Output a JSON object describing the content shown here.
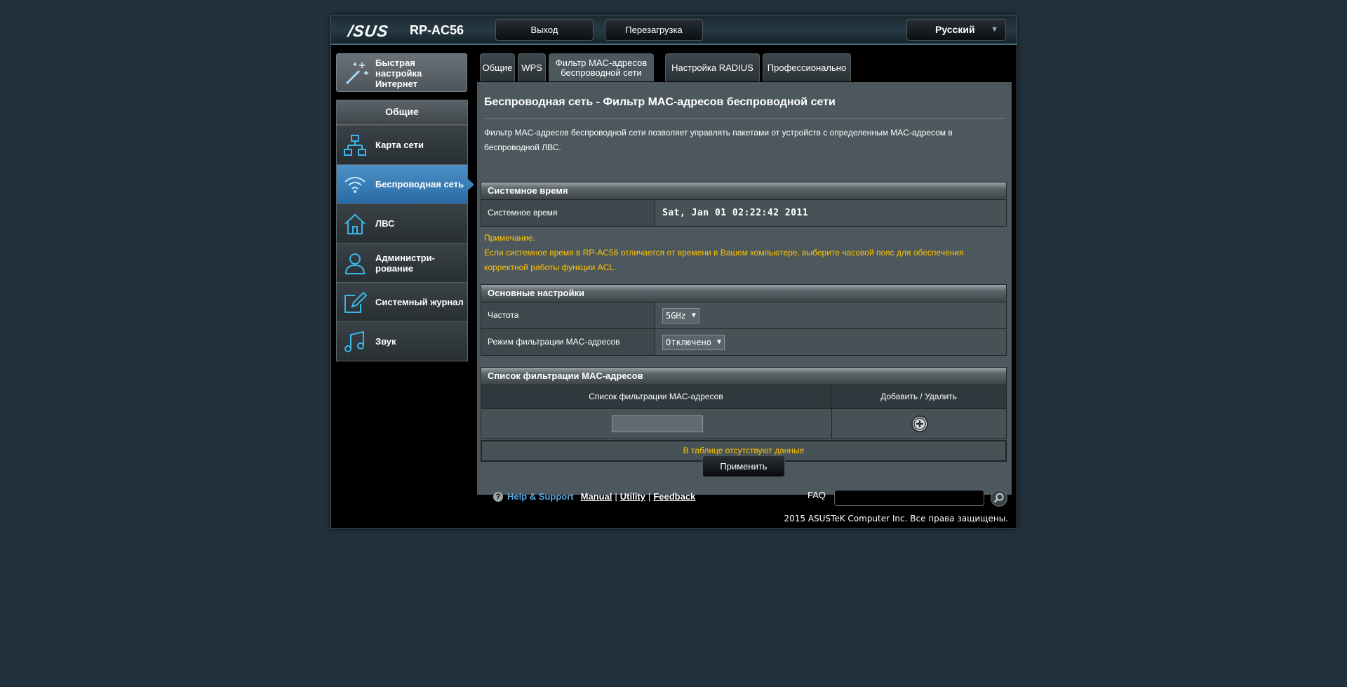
{
  "header": {
    "logo_text": "/SUS",
    "model": "RP-AC56",
    "logout_label": "Выход",
    "reboot_label": "Перезагрузка",
    "language": "Русский"
  },
  "sidebar": {
    "qis_label": "Быстрая настройка Интернет",
    "section_title": "Общие",
    "items": [
      {
        "label": "Карта сети",
        "icon": "network-map-icon"
      },
      {
        "label": "Беспроводная сеть",
        "icon": "wifi-icon"
      },
      {
        "label": "ЛВС",
        "icon": "home-icon"
      },
      {
        "label": "Администри-рование",
        "icon": "admin-icon"
      },
      {
        "label": "Системный журнал",
        "icon": "log-icon"
      },
      {
        "label": "Звук",
        "icon": "music-icon"
      }
    ]
  },
  "tabs": [
    {
      "label": "Общие"
    },
    {
      "label": "WPS"
    },
    {
      "label": "Фильтр MAC-адресов беспроводной сети"
    },
    {
      "label": "Настройка RADIUS"
    },
    {
      "label": "Профессионально"
    }
  ],
  "main": {
    "title": "Беспроводная сеть - Фильтр MAC-адресов беспроводной сети",
    "description": "Фильтр MAC-адресов беспроводной сети позволяет управлять пакетами от устройств с определенным MAC-адресом в беспроводной ЛВС.",
    "system_time_section": "Системное время",
    "system_time_label": "Системное время",
    "system_time_value": "Sat, Jan 01  02:22:42  2011",
    "note_title": "Примечание.",
    "note_text": "Если системное время в RP-AC56 отличается от времени в Вашем компьютере, выберите часовой пояс для обеспечения корректной работы функции ACL.",
    "basic_section": "Основные настройки",
    "band_label": "Частота",
    "band_value": "5GHz",
    "mode_label": "Режим фильтрации MAC-адресов",
    "mode_value": "Отключено",
    "list_section": "Список фильтрации MAC-адресов",
    "list_col1": "Список фильтрации MAC-адресов",
    "list_col2": "Добавить / Удалить",
    "mac_input_value": "",
    "empty_text": "В таблице отсутствуют данные",
    "apply_label": "Применить"
  },
  "footer": {
    "help_label": "Help & Support",
    "manual": "Manual",
    "utility": "Utility",
    "feedback": "Feedback",
    "faq_label": "FAQ",
    "copyright": "2015 ASUSTeK Computer Inc. Все права защищены."
  },
  "colors": {
    "background": "#21303b",
    "accent_blue": "#3a82bb",
    "note_yellow": "#ffc400",
    "help_blue": "#5da9e0"
  }
}
